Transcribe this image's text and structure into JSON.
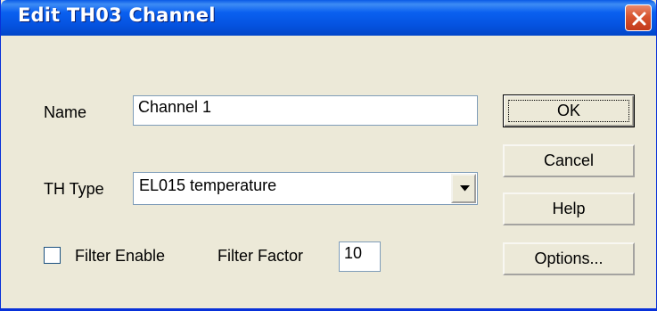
{
  "window": {
    "title": "Edit TH03 Channel",
    "close_icon": "close-icon"
  },
  "form": {
    "name_label": "Name",
    "name_value": "Channel 1",
    "th_type_label": "TH Type",
    "th_type_value": "EL015 temperature",
    "filter_enable_label": "Filter Enable",
    "filter_enable_checked": false,
    "filter_factor_label": "Filter Factor",
    "filter_factor_value": "10"
  },
  "buttons": {
    "ok": "OK",
    "cancel": "Cancel",
    "help": "Help",
    "options": "Options..."
  },
  "colors": {
    "titlebar": "#0553e0",
    "dialog_bg": "#ece9d8",
    "close": "#d8552f"
  }
}
